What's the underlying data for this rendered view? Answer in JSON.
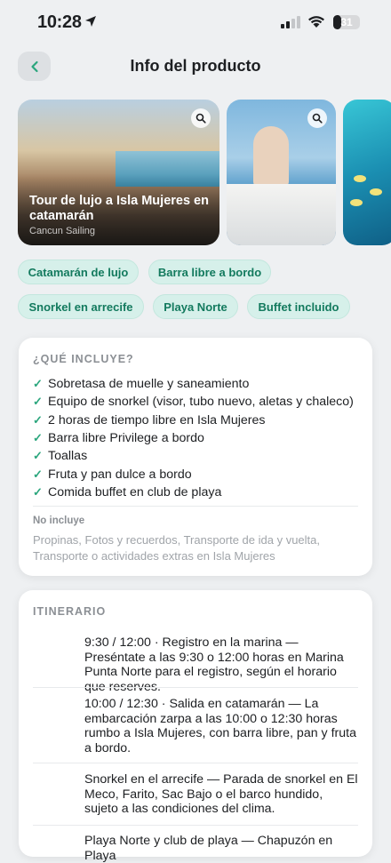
{
  "status": {
    "time": "10:28",
    "battery": "31",
    "battery_level": 0.31
  },
  "header": {
    "title": "Info del producto"
  },
  "gallery": [
    {
      "title": "Tour de lujo a Isla Mujeres en catamarán",
      "subtitle": "Cancun Sailing"
    },
    {
      "title": "",
      "subtitle": ""
    },
    {
      "title": "",
      "subtitle": ""
    }
  ],
  "tags": [
    "Catamarán de lujo",
    "Barra libre a bordo",
    "Snorkel en arrecife",
    "Playa Norte",
    "Buffet incluido"
  ],
  "includes": {
    "label": "¿QUÉ INCLUYE?",
    "items": [
      "Sobretasa de muelle y saneamiento",
      "Equipo de snorkel (visor, tubo nuevo, aletas y chaleco)",
      "2 horas de tiempo libre en Isla Mujeres",
      "Barra libre Privilege a bordo",
      "Toallas",
      "Fruta y pan dulce a bordo",
      "Comida buffet en club de playa"
    ],
    "not_included_label": "No incluye",
    "not_included_text": "Propinas, Fotos y recuerdos, Transporte de ida y vuelta, Transporte o actividades extras en Isla Mujeres"
  },
  "itinerary": {
    "label": "ITINERARIO",
    "steps": [
      "9:30 / 12:00 · Registro en la marina — Preséntate a las 9:30 o 12:00 horas en Marina Punta Norte para el registro, según el horario que reserves.",
      "10:00 / 12:30 · Salida en catamarán — La embarcación zarpa a las 10:00 o 12:30 horas rumbo a Isla Mujeres, con barra libre, pan y fruta a bordo.",
      "Snorkel en el arrecife — Parada de snorkel en El Meco, Farito, Sac Bajo o el barco hundido, sujeto a las condiciones del clima.",
      "Playa Norte y club de playa — Chapuzón en Playa"
    ]
  }
}
